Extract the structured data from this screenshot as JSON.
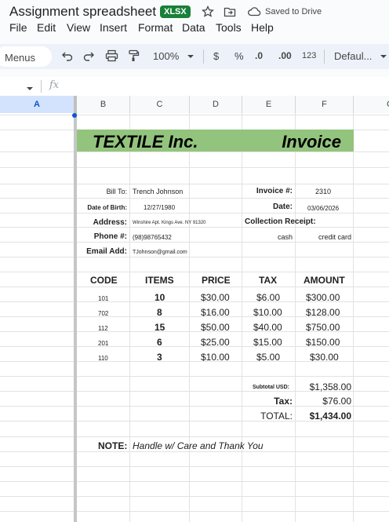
{
  "doc": {
    "title": "Assignment spreadsheet",
    "format_badge": "XLSX",
    "save_status": "Saved to Drive"
  },
  "menu": [
    "File",
    "Edit",
    "View",
    "Insert",
    "Format",
    "Data",
    "Tools",
    "Help"
  ],
  "toolbar": {
    "menus_label": "Menus",
    "zoom": "100%",
    "currency": "$",
    "percent": "%",
    "decrease_decimal": ".0",
    "increase_decimal": ".00",
    "number_format": "123",
    "font": "Defaul..."
  },
  "formula_bar": {
    "fx": "fx"
  },
  "columns": [
    "A",
    "B",
    "C",
    "D",
    "E",
    "F",
    "G"
  ],
  "sheet": {
    "company": "TEXTILE Inc.",
    "doc_type": "Invoice",
    "bill_to_label": "Bill To:",
    "bill_to_value": "Trench Johnson",
    "dob_label": "Date of Birth:",
    "dob_value": "12/27/1980",
    "address_label": "Address:",
    "address_value": "Winshire Apt. Kings Ave. NY 91320",
    "phone_label": "Phone #:",
    "phone_value": "(98)98765432",
    "email_label": "Email Add:",
    "email_value": "TJohnson@gmail.com",
    "invoice_no_label": "Invoice #:",
    "invoice_no_value": "2310",
    "date_label": "Date:",
    "date_value": "03/06/2026",
    "receipt_label": "Collection Receipt:",
    "receipt_cash": "cash",
    "receipt_credit": "credit card",
    "headers": [
      "CODE",
      "ITEMS",
      "PRICE",
      "TAX",
      "AMOUNT"
    ],
    "rows": [
      {
        "code": "101",
        "items": "10",
        "price": "$30.00",
        "tax": "$6.00",
        "amount": "$300.00"
      },
      {
        "code": "702",
        "items": "8",
        "price": "$16.00",
        "tax": "$10.00",
        "amount": "$128.00"
      },
      {
        "code": "112",
        "items": "15",
        "price": "$50.00",
        "tax": "$40.00",
        "amount": "$750.00"
      },
      {
        "code": "201",
        "items": "6",
        "price": "$25.00",
        "tax": "$15.00",
        "amount": "$150.00"
      },
      {
        "code": "110",
        "items": "3",
        "price": "$10.00",
        "tax": "$5.00",
        "amount": "$30.00"
      }
    ],
    "subtotal_label": "Subtotal USD:",
    "subtotal_value": "$1,358.00",
    "tax_label": "Tax:",
    "tax_value": "$76.00",
    "total_label": "TOTAL:",
    "total_value": "$1,434.00",
    "note_label": "NOTE:",
    "note_value": "Handle w/ Care and Thank You"
  },
  "colors": {
    "banner": "#93c47d",
    "badge": "#188038",
    "selected_col": "#d3e3fd"
  }
}
